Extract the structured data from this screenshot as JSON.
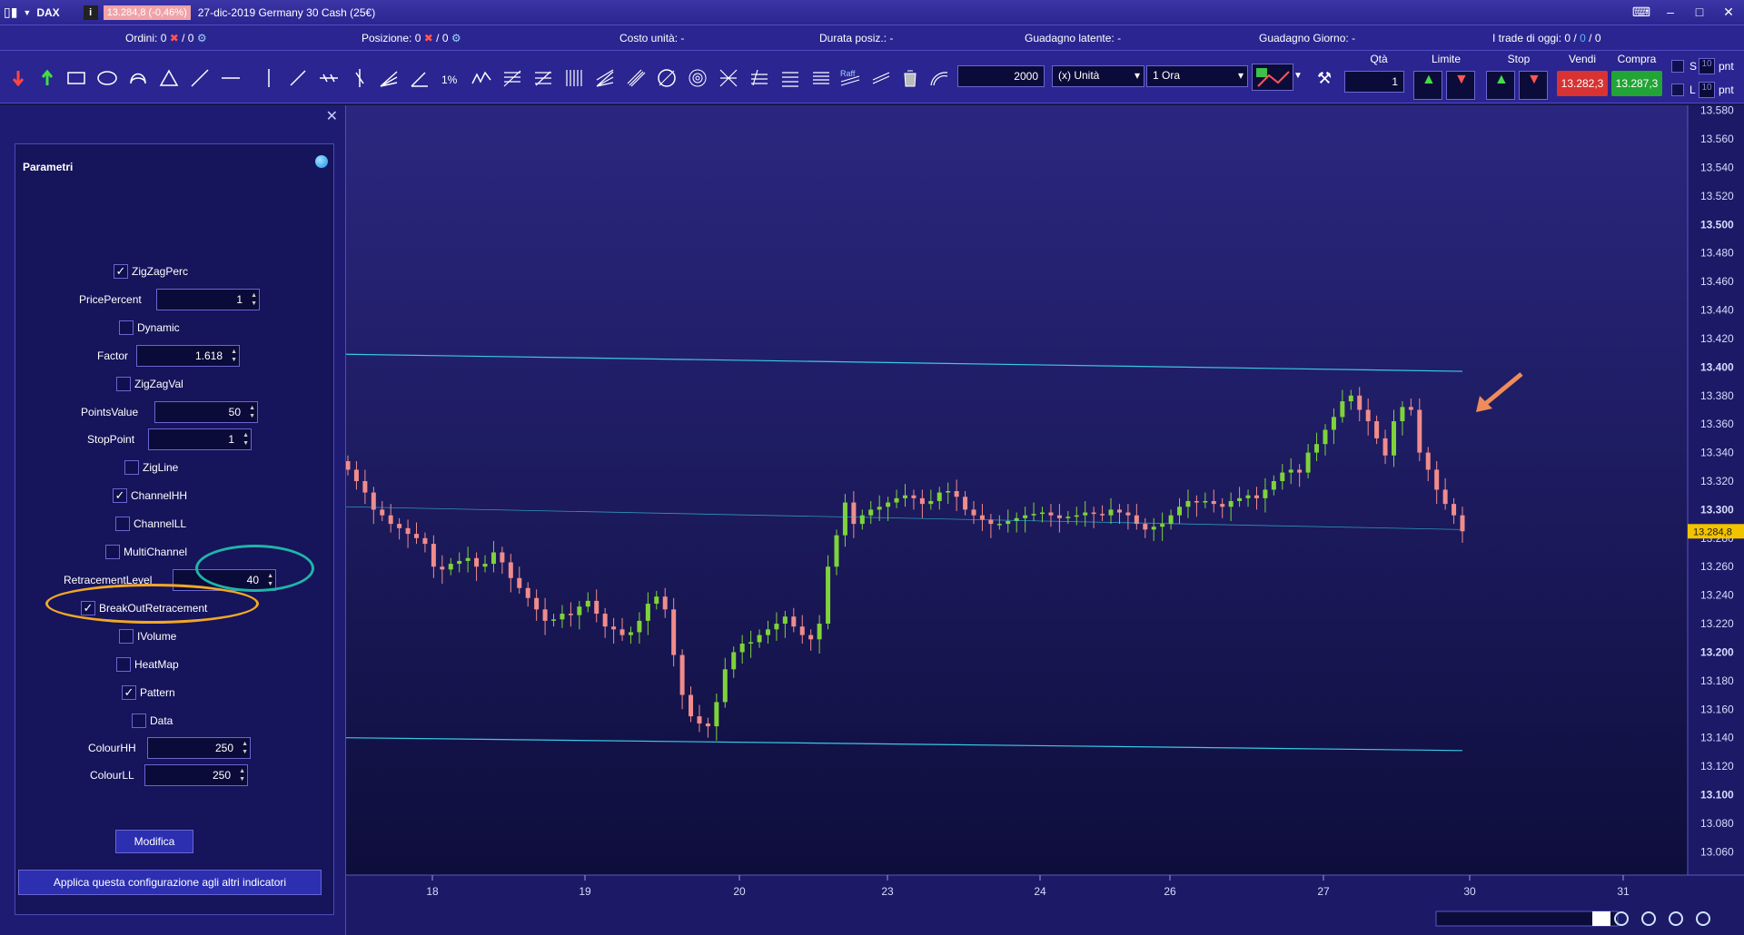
{
  "titlebar": {
    "symbol": "DAX",
    "price_badge": "13.284,8 (-0,46%)",
    "info": "i",
    "instrument": "27-dic-2019 Germany 30 Cash (25€)"
  },
  "status": {
    "ordini_label": "Ordini:",
    "ordini_val": "0",
    "ordini_sep": "/ 0",
    "posizione_label": "Posizione:",
    "posizione_val": "0",
    "posizione_sep": "/ 0",
    "costo": "Costo unità: -",
    "durata": "Durata posiz.: -",
    "guadagno_lat": "Guadagno latente: -",
    "guadagno_giorno": "Guadagno Giorno: -",
    "trade_oggi": "I trade di oggi:",
    "trade_vals": [
      "0",
      "0",
      "0"
    ]
  },
  "toolbar": {
    "qty_input": "2000",
    "unit_select": "(x) Unità",
    "timeframe_select": "1 Ora",
    "qta_label": "Qtà",
    "qta_value": "1",
    "limite_label": "Limite",
    "stop_label": "Stop",
    "vendi_label": "Vendi",
    "compra_label": "Compra",
    "vendi_price": "13.282,3",
    "compra_price": "13.287,3",
    "s_label": "S",
    "l_label": "L",
    "pnt_val": "10",
    "pnt_label": "pnt",
    "raff_label": "Raff"
  },
  "panel": {
    "title": "Parametri",
    "fields": {
      "zigzagperc": "ZigZagPerc",
      "pricepercent_label": "PricePercent",
      "pricepercent_val": "1",
      "dynamic": "Dynamic",
      "factor_label": "Factor",
      "factor_val": "1.618",
      "zigzagval": "ZigZagVal",
      "pointsvalue_label": "PointsValue",
      "pointsvalue_val": "50",
      "stoppoint_label": "StopPoint",
      "stoppoint_val": "1",
      "zigline": "ZigLine",
      "channelhh": "ChannelHH",
      "channelll": "ChannelLL",
      "multichannel": "MultiChannel",
      "retracement_label": "RetracementLevel",
      "retracement_val": "40",
      "breakout": "BreakOutRetracement",
      "ivolume": "IVolume",
      "heatmap": "HeatMap",
      "pattern": "Pattern",
      "data": "Data",
      "colourhh_label": "ColourHH",
      "colourhh_val": "250",
      "colourll_label": "ColourLL",
      "colourll_val": "250"
    },
    "checked": {
      "zigzagperc": true,
      "dynamic": false,
      "zigzagval": false,
      "zigline": false,
      "channelhh": true,
      "channelll": false,
      "multichannel": false,
      "breakout": true,
      "ivolume": false,
      "heatmap": false,
      "pattern": true,
      "data": false
    },
    "modifica": "Modifica",
    "apply": "Applica questa configurazione agli altri indicatori"
  },
  "colors": {
    "bull": "#7fd33a",
    "bear": "#f08c8c",
    "channel": "#38c9e6",
    "bg_top": "#2b2780",
    "bg_bottom": "#0e0e3c",
    "highlight_cyan": "#1fb5a8",
    "highlight_orange": "#f0a826",
    "arrow": "#f08c5a",
    "last_price_bg": "#f2c400"
  },
  "chart_data": {
    "type": "candlestick",
    "x_ticks": [
      "18",
      "19",
      "20",
      "23",
      "24",
      "26",
      "27",
      "30",
      "31"
    ],
    "y_ticks": [
      "13.580",
      "13.560",
      "13.540",
      "13.520",
      "13.500",
      "13.480",
      "13.460",
      "13.440",
      "13.420",
      "13.400",
      "13.380",
      "13.360",
      "13.340",
      "13.320",
      "13.300",
      "13.280",
      "13.260",
      "13.240",
      "13.220",
      "13.200",
      "13.180",
      "13.160",
      "13.140",
      "13.120",
      "13.100",
      "13.080",
      "13.060"
    ],
    "bold_ticks": [
      "13.500",
      "13.400",
      "13.300",
      "13.200",
      "13.100"
    ],
    "ylim": [
      13050,
      13590
    ],
    "last_price": "13.284,8",
    "close": [
      13328,
      13320,
      13312,
      13300,
      13296,
      13290,
      13287,
      13283,
      13280,
      13276,
      13260,
      13258,
      13262,
      13264,
      13266,
      13260,
      13262,
      13270,
      13263,
      13252,
      13245,
      13238,
      13230,
      13222,
      13223,
      13227,
      13226,
      13232,
      13236,
      13227,
      13218,
      13216,
      13212,
      13214,
      13222,
      13234,
      13239,
      13230,
      13198,
      13170,
      13155,
      13150,
      13148,
      13165,
      13188,
      13200,
      13206,
      13207,
      13212,
      13216,
      13220,
      13225,
      13218,
      13212,
      13209,
      13220,
      13260,
      13282,
      13305,
      13290,
      13296,
      13300,
      13302,
      13305,
      13308,
      13310,
      13308,
      13304,
      13306,
      13312,
      13313,
      13309,
      13300,
      13296,
      13293,
      13290,
      13290,
      13292,
      13294,
      13296,
      13297,
      13298,
      13296,
      13294,
      13295,
      13296,
      13298,
      13297,
      13296,
      13300,
      13298,
      13296,
      13290,
      13286,
      13288,
      13290,
      13296,
      13302,
      13306,
      13305,
      13306,
      13304,
      13302,
      13306,
      13308,
      13310,
      13308,
      13314,
      13320,
      13326,
      13328,
      13326,
      13340,
      13346,
      13356,
      13365,
      13376,
      13380,
      13370,
      13362,
      13350,
      13338,
      13362,
      13372,
      13370,
      13340,
      13328,
      13314,
      13304,
      13296,
      13284.8
    ]
  }
}
